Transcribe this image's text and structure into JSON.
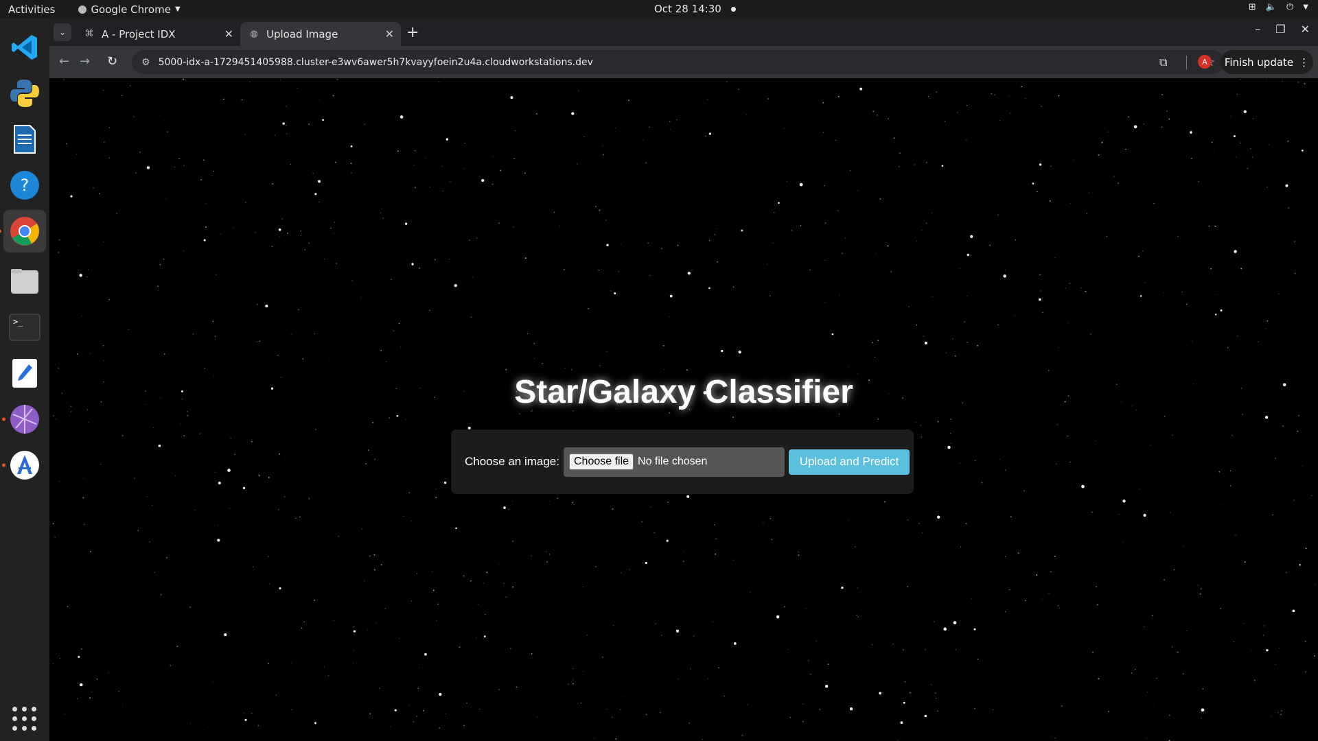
{
  "topbar": {
    "activities": "Activities",
    "app_name": "Google Chrome",
    "datetime": "Oct 28  14:30"
  },
  "dock": {
    "apps": [
      "vscode-icon",
      "python-icon",
      "writer-icon",
      "help-icon",
      "chrome-icon",
      "files-icon",
      "terminal-icon",
      "text-editor-icon",
      "network-icon",
      "app-center-icon"
    ]
  },
  "browser": {
    "tabs": [
      {
        "title": "A - Project IDX"
      },
      {
        "title": "Upload Image"
      }
    ],
    "url": "5000-idx-a-1729451405988.cluster-e3wv6awer5h7kvayyfoein2u4a.cloudworkstations.dev",
    "profile_initial": "A",
    "finish_update": "Finish update"
  },
  "page": {
    "title": "Star/Galaxy Classifier",
    "form": {
      "label": "Choose an image:",
      "choose_file": "Choose file",
      "file_status": "No file chosen",
      "submit": "Upload and Predict"
    }
  },
  "colors": {
    "page_background": "#000000",
    "button": "#5bc0de",
    "form_background": "#1c1c1c",
    "orange_dot": "#e95420"
  }
}
